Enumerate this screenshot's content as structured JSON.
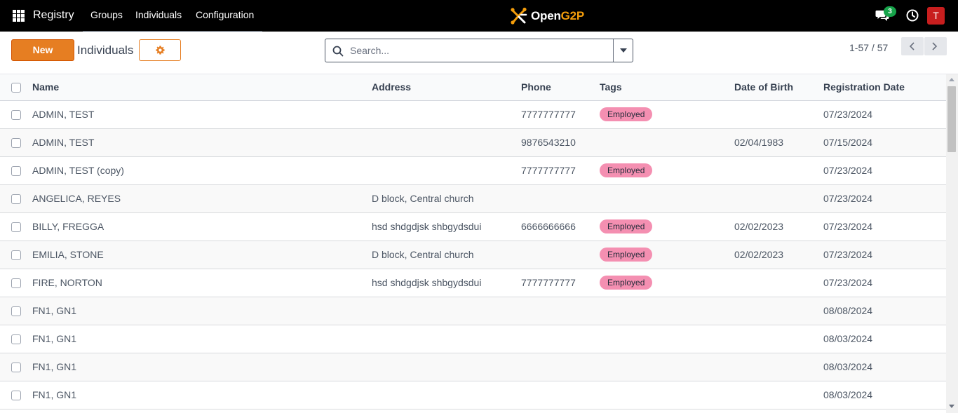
{
  "navbar": {
    "app_name": "Registry",
    "menus": [
      "Groups",
      "Individuals",
      "Configuration"
    ],
    "logo": {
      "text_white": "Open",
      "text_orange": "G2P"
    },
    "chat_badge": "3",
    "avatar_initial": "T"
  },
  "control_panel": {
    "new_label": "New",
    "title": "Individuals",
    "search_placeholder": "Search...",
    "pager_value": "1-57 / 57"
  },
  "table": {
    "columns": [
      "Name",
      "Address",
      "Phone",
      "Tags",
      "Date of Birth",
      "Registration Date"
    ],
    "rows": [
      {
        "name": "ADMIN, TEST",
        "address": "",
        "phone": "7777777777",
        "tag": "Employed",
        "dob": "",
        "reg_date": "07/23/2024"
      },
      {
        "name": "ADMIN, TEST",
        "address": "",
        "phone": "9876543210",
        "tag": "",
        "dob": "02/04/1983",
        "reg_date": "07/15/2024"
      },
      {
        "name": "ADMIN, TEST (copy)",
        "address": "",
        "phone": "7777777777",
        "tag": "Employed",
        "dob": "",
        "reg_date": "07/23/2024"
      },
      {
        "name": "ANGELICA, REYES",
        "address": "D block, Central church",
        "phone": "",
        "tag": "",
        "dob": "",
        "reg_date": "07/23/2024"
      },
      {
        "name": "BILLY, FREGGA",
        "address": "hsd shdgdjsk shbgydsdui",
        "phone": "6666666666",
        "tag": "Employed",
        "dob": "02/02/2023",
        "reg_date": "07/23/2024"
      },
      {
        "name": "EMILIA, STONE",
        "address": "D block, Central church",
        "phone": "",
        "tag": "Employed",
        "dob": "02/02/2023",
        "reg_date": "07/23/2024"
      },
      {
        "name": "FIRE, NORTON",
        "address": "hsd shdgdjsk shbgydsdui",
        "phone": "7777777777",
        "tag": "Employed",
        "dob": "",
        "reg_date": "07/23/2024"
      },
      {
        "name": "FN1, GN1",
        "address": "",
        "phone": "",
        "tag": "",
        "dob": "",
        "reg_date": "08/08/2024"
      },
      {
        "name": "FN1, GN1",
        "address": "",
        "phone": "",
        "tag": "",
        "dob": "",
        "reg_date": "08/03/2024"
      },
      {
        "name": "FN1, GN1",
        "address": "",
        "phone": "",
        "tag": "",
        "dob": "",
        "reg_date": "08/03/2024"
      },
      {
        "name": "FN1, GN1",
        "address": "",
        "phone": "",
        "tag": "",
        "dob": "",
        "reg_date": "08/03/2024"
      }
    ]
  },
  "colors": {
    "navbar_bg": "#000000",
    "accent_orange": "#e67e22",
    "tag_pink": "#f48fb1",
    "badge_green": "#16a34a",
    "avatar_red": "#c81e1e"
  },
  "icons": [
    "apps-grid-icon",
    "logo-mark-icon",
    "chat-icon",
    "clock-icon",
    "gear-icon",
    "search-icon",
    "caret-down-icon",
    "chevron-left-icon",
    "chevron-right-icon"
  ]
}
